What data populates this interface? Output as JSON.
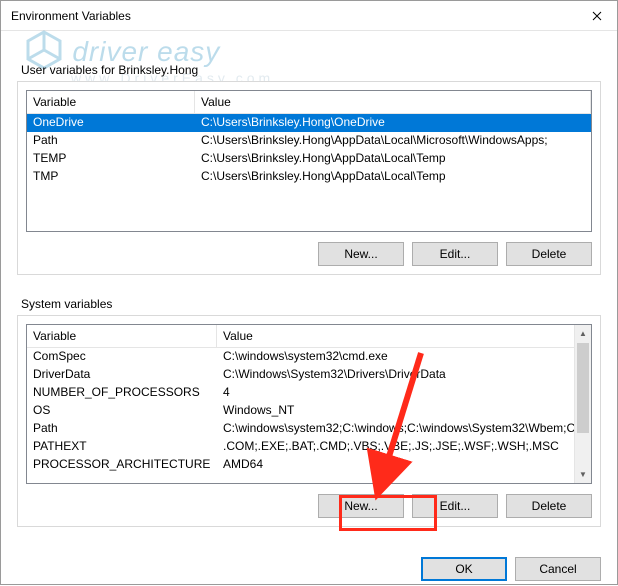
{
  "window": {
    "title": "Environment Variables"
  },
  "watermark": {
    "line1": "driver easy",
    "line2": "www.DriverEasy.com"
  },
  "user_section": {
    "label": "User variables for Brinksley.Hong",
    "columns": {
      "variable": "Variable",
      "value": "Value"
    },
    "rows": [
      {
        "variable": "OneDrive",
        "value": "C:\\Users\\Brinksley.Hong\\OneDrive",
        "selected": true
      },
      {
        "variable": "Path",
        "value": "C:\\Users\\Brinksley.Hong\\AppData\\Local\\Microsoft\\WindowsApps;",
        "selected": false
      },
      {
        "variable": "TEMP",
        "value": "C:\\Users\\Brinksley.Hong\\AppData\\Local\\Temp",
        "selected": false
      },
      {
        "variable": "TMP",
        "value": "C:\\Users\\Brinksley.Hong\\AppData\\Local\\Temp",
        "selected": false
      }
    ],
    "buttons": {
      "new": "New...",
      "edit": "Edit...",
      "delete": "Delete"
    }
  },
  "sys_section": {
    "label": "System variables",
    "columns": {
      "variable": "Variable",
      "value": "Value"
    },
    "rows": [
      {
        "variable": "ComSpec",
        "value": "C:\\windows\\system32\\cmd.exe"
      },
      {
        "variable": "DriverData",
        "value": "C:\\Windows\\System32\\Drivers\\DriverData"
      },
      {
        "variable": "NUMBER_OF_PROCESSORS",
        "value": "4"
      },
      {
        "variable": "OS",
        "value": "Windows_NT"
      },
      {
        "variable": "Path",
        "value": "C:\\windows\\system32;C:\\windows;C:\\windows\\System32\\Wbem;C..."
      },
      {
        "variable": "PATHEXT",
        "value": ".COM;.EXE;.BAT;.CMD;.VBS;.VBE;.JS;.JSE;.WSF;.WSH;.MSC"
      },
      {
        "variable": "PROCESSOR_ARCHITECTURE",
        "value": "AMD64"
      }
    ],
    "buttons": {
      "new": "New...",
      "edit": "Edit...",
      "delete": "Delete"
    }
  },
  "dialog_buttons": {
    "ok": "OK",
    "cancel": "Cancel"
  }
}
